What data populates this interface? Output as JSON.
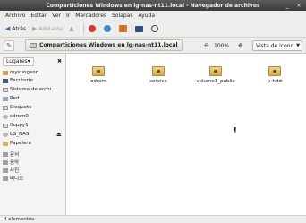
{
  "window": {
    "title": "Comparticiones Windows en lg-nas-nt11.local - Navegador de archivos",
    "minimize": "_",
    "close": "✕"
  },
  "menu": [
    "Archivo",
    "Editar",
    "Ver",
    "Ir",
    "Marcadores",
    "Solapas",
    "Ayuda"
  ],
  "toolbar": {
    "back_label": "Atrás",
    "forward_label": "Adelante",
    "icons": [
      "back-arrow-icon",
      "forward-arrow-icon",
      "up-arrow-icon",
      "stop-icon",
      "reload-icon",
      "home-icon",
      "computer-icon",
      "search-icon"
    ]
  },
  "location": {
    "path_label": "Comparticiones Windows en lg-nas-nt11.local",
    "zoom_out": "⊖",
    "zoom_level": "100%",
    "zoom_in": "⊕",
    "view_mode": "Vista de icono"
  },
  "sidebar": {
    "header_label": "Lugares",
    "header_caret": "▾",
    "close": "✖",
    "items": [
      {
        "label": "mysungeon",
        "icon": "home-folder-icon"
      },
      {
        "label": "Escritorio",
        "icon": "desktop-icon"
      },
      {
        "label": "Sistema de archi...",
        "icon": "filesystem-icon"
      },
      {
        "label": "Red",
        "icon": "network-icon"
      },
      {
        "label": "Disquete",
        "icon": "floppy-icon"
      },
      {
        "label": "cdrom0",
        "icon": "cdrom-icon"
      },
      {
        "label": "floppy1",
        "icon": "floppy-icon"
      },
      {
        "label": "LG_NAS",
        "icon": "network-drive-icon"
      },
      {
        "label": "Papelera",
        "icon": "trash-icon"
      },
      {
        "label": "문서",
        "icon": "bookmark-icon"
      },
      {
        "label": "음악",
        "icon": "bookmark-icon"
      },
      {
        "label": "사진",
        "icon": "bookmark-icon"
      },
      {
        "label": "비디오",
        "icon": "bookmark-icon"
      }
    ],
    "eject": "⏏"
  },
  "files": [
    {
      "name": "cdrom",
      "icon": "shared-folder-icon"
    },
    {
      "name": "service",
      "icon": "shared-folder-icon"
    },
    {
      "name": "volume1_public",
      "icon": "shared-folder-icon"
    },
    {
      "name": "x-hdd",
      "icon": "shared-folder-icon"
    }
  ],
  "status": {
    "text": "4 elementos"
  }
}
